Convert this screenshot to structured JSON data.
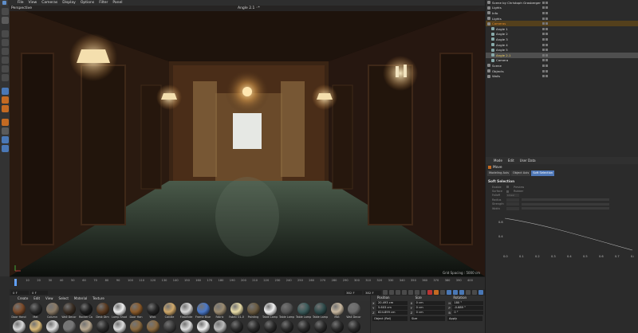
{
  "menubar": {
    "items": [
      "File",
      "View",
      "Cameras",
      "Display",
      "Options",
      "Filter",
      "Panel"
    ]
  },
  "viewport": {
    "label": "Perspective",
    "camera": "Angle 2.1 ◦*",
    "grid_spacing": "Grid Spacing : 5000 cm"
  },
  "timeline": {
    "ticks": [
      "0",
      "10",
      "20",
      "30",
      "40",
      "50",
      "60",
      "70",
      "80",
      "90",
      "100",
      "110",
      "120",
      "130",
      "140",
      "150",
      "160",
      "170",
      "180",
      "190",
      "200",
      "210",
      "220",
      "230",
      "240",
      "250",
      "260",
      "270",
      "280",
      "290",
      "300",
      "310",
      "320",
      "330",
      "340",
      "350",
      "360",
      "370",
      "380",
      "390",
      "400"
    ],
    "end_field": "0 F"
  },
  "transport": {
    "start": "0 F",
    "current": "0 F",
    "end": "382 F",
    "max": "382 F"
  },
  "materials": {
    "menu": [
      "Create",
      "Edit",
      "View",
      "Select",
      "Material",
      "Texture"
    ],
    "items": [
      {
        "label": "Door Hand",
        "color": "#7a4a2a"
      },
      {
        "label": "Mat",
        "color": "#2a2a2a"
      },
      {
        "label": "Column",
        "color": "#8a7a66"
      },
      {
        "label": "Wall Decor",
        "color": "#3a2e24"
      },
      {
        "label": "Rocker Ca",
        "color": "#1e1e1e"
      },
      {
        "label": "Desk Dim",
        "color": "#5a3a20"
      },
      {
        "label": "Lamp Shad",
        "color": "#eeeeee"
      },
      {
        "label": "Door Han",
        "color": "#8a5a2a"
      },
      {
        "label": "Wick",
        "color": "#242424"
      },
      {
        "label": "Candle",
        "color": "#cfa86a"
      },
      {
        "label": "Flatwhite",
        "color": "#d8d8d8"
      },
      {
        "label": "Frame Blue",
        "color": "#4a78c8"
      },
      {
        "label": "Fabric",
        "color": "#9a8a70"
      },
      {
        "label": "Fabric 01-0",
        "color": "#e8dca8"
      },
      {
        "label": "Painting",
        "color": "#6a5a40"
      },
      {
        "label": "Table Lamp",
        "color": "#f0f0f0"
      },
      {
        "label": "Table Lamp",
        "color": "#555555"
      },
      {
        "label": "Table Lamp",
        "color": "#3a5a5a"
      },
      {
        "label": "Table Lamp",
        "color": "#2e4a4a"
      },
      {
        "label": "Mat",
        "color": "#c8b8a0"
      },
      {
        "label": "Wall Decor",
        "color": "#6a6a6a"
      },
      {
        "label": "",
        "color": "#d8d8d8"
      },
      {
        "label": "",
        "color": "#d8b878"
      },
      {
        "label": "",
        "color": "#dddddd"
      },
      {
        "label": "",
        "color": "#777777"
      },
      {
        "label": "",
        "color": "#b8a890"
      },
      {
        "label": "",
        "color": "#2a2a2a"
      },
      {
        "label": "",
        "color": "#dddddd"
      },
      {
        "label": "",
        "color": "#8a6a40"
      },
      {
        "label": "",
        "color": "#8a6a40"
      },
      {
        "label": "",
        "color": "#3a3a3a"
      },
      {
        "label": "",
        "color": "#dddddd"
      },
      {
        "label": "",
        "color": "#eeeeee"
      },
      {
        "label": "",
        "color": "#bbbbbb"
      },
      {
        "label": "",
        "color": "#2a2a2a"
      },
      {
        "label": "",
        "color": "#2a2a2a"
      },
      {
        "label": "",
        "color": "#2a2a2a"
      },
      {
        "label": "",
        "color": "#2a2a2a"
      },
      {
        "label": "",
        "color": "#2a2a2a"
      },
      {
        "label": "",
        "color": "#2a2a2a"
      },
      {
        "label": "",
        "color": "#2a2a2a"
      },
      {
        "label": "",
        "color": "#2a2a2a"
      }
    ]
  },
  "coords": {
    "headers": [
      "Position",
      "Size",
      "Rotation"
    ],
    "rows": [
      [
        {
          "axis": "X",
          "value": "20.493 cm"
        },
        {
          "axis": "X",
          "value": "0 cm"
        },
        {
          "axis": "H",
          "value": "180 °"
        }
      ],
      [
        {
          "axis": "Y",
          "value": "5.603 cm"
        },
        {
          "axis": "Y",
          "value": "0 cm"
        },
        {
          "axis": "P",
          "value": "-0.689 °"
        }
      ],
      [
        {
          "axis": "Z",
          "value": "624.899 cm"
        },
        {
          "axis": "Z",
          "value": "0 cm"
        },
        {
          "axis": "B",
          "value": "0 °"
        }
      ]
    ],
    "mode": "Object (Rel)",
    "size_mode": "Size",
    "apply": "Apply"
  },
  "objects": [
    {
      "label": "Scene by Christoph Grasberger",
      "style": "",
      "indent": 2
    },
    {
      "label": "Lights",
      "style": "",
      "indent": 2
    },
    {
      "label": "Info",
      "style": "",
      "indent": 2
    },
    {
      "label": "Lights",
      "style": "",
      "indent": 2
    },
    {
      "label": "Cameras",
      "style": "orange",
      "indent": 2
    },
    {
      "label": "Angle 1",
      "style": "",
      "indent": 7
    },
    {
      "label": "Angle 2",
      "style": "",
      "indent": 7
    },
    {
      "label": "Angle 3",
      "style": "",
      "indent": 7
    },
    {
      "label": "Angle 4",
      "style": "",
      "indent": 7
    },
    {
      "label": "Angle 5",
      "style": "",
      "indent": 7
    },
    {
      "label": "Angle 2.1",
      "style": "yellow",
      "indent": 7
    },
    {
      "label": "Camera",
      "style": "",
      "indent": 7
    },
    {
      "label": "Scene",
      "style": "",
      "indent": 2
    },
    {
      "label": "Objects",
      "style": "",
      "indent": 2
    },
    {
      "label": "Walls",
      "style": "",
      "indent": 2
    }
  ],
  "attributes": {
    "menu": [
      "Mode",
      "Edit",
      "User Data"
    ],
    "title": "Move",
    "tabs": [
      "Modeling Axis",
      "Object Axis",
      "Soft Selection"
    ],
    "section": "Soft Selection",
    "rows": [
      {
        "k": "Enable",
        "extra": "Preview"
      },
      {
        "k": "Surface",
        "extra": "Rubber"
      },
      {
        "k": "Falloff",
        "extra": "Linear"
      },
      {
        "k": "Radius",
        "extra": ""
      },
      {
        "k": "Strength",
        "extra": ""
      },
      {
        "k": "Width",
        "extra": ""
      }
    ],
    "curve": {
      "y_ticks": [
        "0.8",
        "0.4"
      ],
      "x_ticks": [
        "0.0",
        "0.1",
        "0.2",
        "0.3",
        "0.4",
        "0.5",
        "0.6",
        "0.7",
        "0.8"
      ]
    }
  }
}
